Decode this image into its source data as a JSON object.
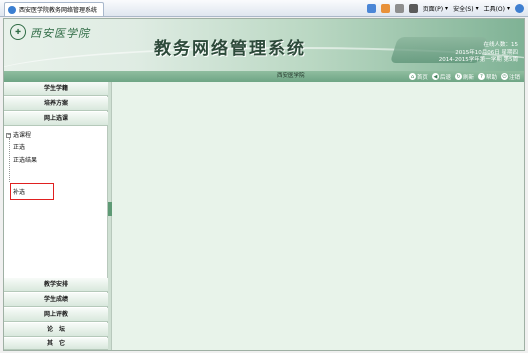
{
  "browser": {
    "tab_title": "西安医学院教务网络管理系统",
    "toolbar": {
      "page_label": "页面(P)",
      "safety_label": "安全(S)",
      "tools_label": "工具(O)"
    }
  },
  "header": {
    "school_name": "西安医学院",
    "system_title": "教务网络管理系统",
    "online_count": "在线人数：15",
    "date": "2015年10月06日 星期四",
    "term": "2014-2015学年第一学期 第5周",
    "college": "西安医学院",
    "quick_links": [
      "首页",
      "后退",
      "刷新",
      "帮助",
      "注销"
    ]
  },
  "sidebar": {
    "menu_top": [
      "学生学籍",
      "培养方案",
      "网上选课"
    ],
    "tree": {
      "root": "选课程",
      "children": [
        "正选",
        "正选结果",
        "补选"
      ]
    },
    "menu_bottom": [
      "教学安排",
      "学生成绩",
      "网上评教",
      "论　坛",
      "其　它"
    ]
  },
  "colors": {
    "accent_green": "#6ea585",
    "highlight_red": "#e02020"
  }
}
